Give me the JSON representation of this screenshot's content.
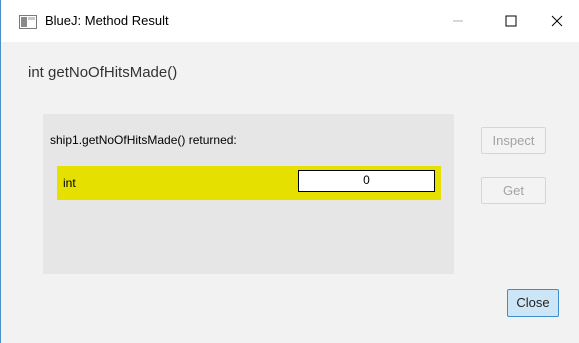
{
  "window": {
    "title": "BlueJ:  Method Result",
    "controls": {
      "minimize_icon": "minimize-icon",
      "maximize_icon": "maximize-icon",
      "close_icon": "close-icon"
    },
    "accent_color": "#4a90c8"
  },
  "method": {
    "signature": "int getNoOfHitsMade()"
  },
  "result": {
    "call_text": "ship1.getNoOfHitsMade() returned:",
    "type": "int",
    "value": "0",
    "highlight_color": "#e6e000"
  },
  "buttons": {
    "inspect": "Inspect",
    "get": "Get",
    "close": "Close"
  }
}
